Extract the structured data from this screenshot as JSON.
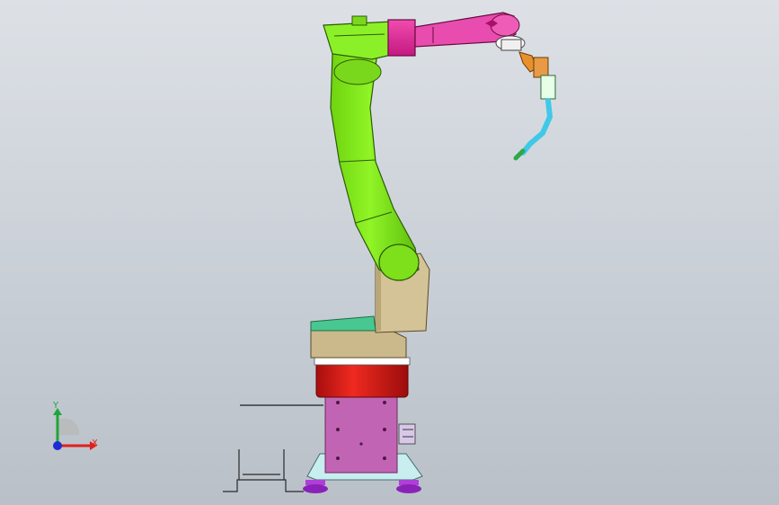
{
  "triad": {
    "x_label": "X",
    "y_label": "Y",
    "x_color": "#e0201c",
    "y_color": "#1fa53a",
    "z_color": "#1c2bd6"
  },
  "model": {
    "colors": {
      "arm": "#86f020",
      "forearm": "#e82c9c",
      "shoulder": "#c8b88a",
      "base_ring": "#e61717",
      "cabinet": "#c264b4",
      "foot_plate": "#c8eef0",
      "feet": "#9a2bc8",
      "torch": "#40c8e8",
      "torch_tip": "#2ea84a",
      "cover": "#48c890"
    }
  }
}
